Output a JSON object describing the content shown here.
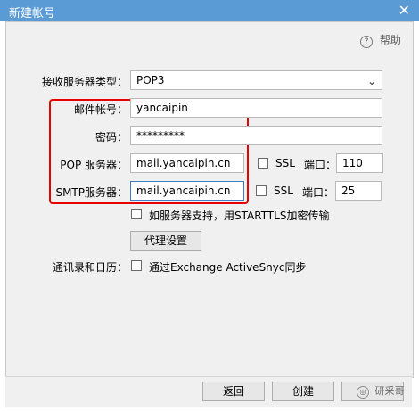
{
  "window": {
    "title": "新建帐号"
  },
  "help": {
    "label": "帮助"
  },
  "server_type": {
    "label": "接收服务器类型：",
    "value": "POP3"
  },
  "account": {
    "label": "邮件帐号：",
    "value": "yancaipin"
  },
  "password": {
    "label": "密码：",
    "value": "*********"
  },
  "pop": {
    "label": "POP 服务器：",
    "value": "mail.yancaipin.cn",
    "ssl_label": "SSL",
    "port_label": "端口：",
    "port_value": "110"
  },
  "smtp": {
    "label": "SMTP服务器：",
    "value": "mail.yancaipin.cn",
    "ssl_label": "SSL",
    "port_label": "端口：",
    "port_value": "25"
  },
  "starttls": {
    "label": "如服务器支持，用STARTTLS加密传输"
  },
  "proxy_button": {
    "label": "代理设置"
  },
  "exchange": {
    "label": "通讯录和日历：",
    "checkbox_label": "通过Exchange ActiveSnyc同步"
  },
  "footer": {
    "back": "返回",
    "create": "创建",
    "watermark": "研采哥"
  },
  "colors": {
    "titlebar": "#5b9bd5",
    "highlight": "#e60000"
  }
}
